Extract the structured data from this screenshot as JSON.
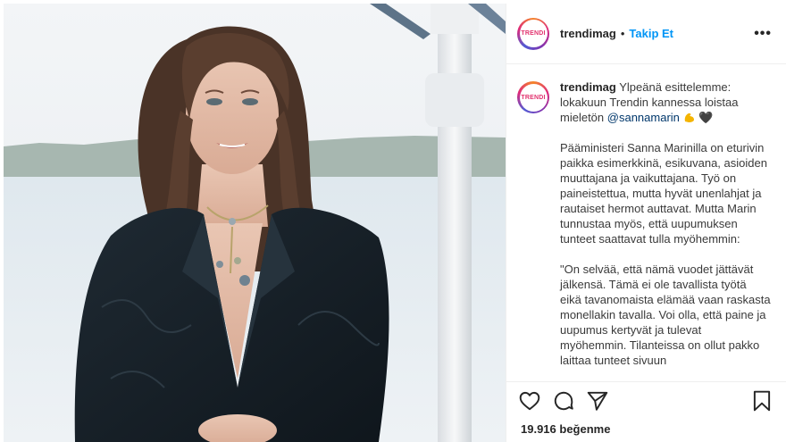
{
  "post": {
    "username": "trendimag",
    "avatar_text": "TRENDI",
    "separator": "•",
    "follow_label": "Takip Et",
    "more_label": "•••"
  },
  "caption": {
    "username": "trendimag",
    "line1": "Ylpeänä esittelemme: lokakuun Trendin kannessa loistaa mieletön",
    "mention": "@sannamarin",
    "emoji_1": "muscle-emoji",
    "emoji_2": "black-heart-emoji",
    "heart_glyph": "🖤",
    "paragraph2": "Pääministeri Sanna Marinilla on eturivin paikka esimerkkinä, esikuvana, asioiden muuttajana ja vaikuttajana. Työ on paineistettua, mutta hyvät unenlahjat ja rautaiset hermot auttavat. Mutta Marin tunnustaa myös, että uupumuksen tunteet saattavat tulla myöhemmin:",
    "paragraph3": "\"On selvää, että nämä vuodet jättävät jälkensä. Tämä ei ole tavallista työtä eikä tavanomaista elämää vaan raskasta monellakin tavalla. Voi olla, että paine ja uupumus kertyvät ja tulevat myöhemmin. Tilanteissa on ollut pakko laittaa tunteet sivuun"
  },
  "actions": {
    "icons": [
      "heart-icon",
      "comment-icon",
      "share-icon",
      "bookmark-icon"
    ],
    "likes_count": "19.916",
    "likes_label": "beğenme"
  },
  "colors": {
    "follow": "#0095f6",
    "mention": "#00376b",
    "text": "#262626",
    "border": "#efefef"
  }
}
